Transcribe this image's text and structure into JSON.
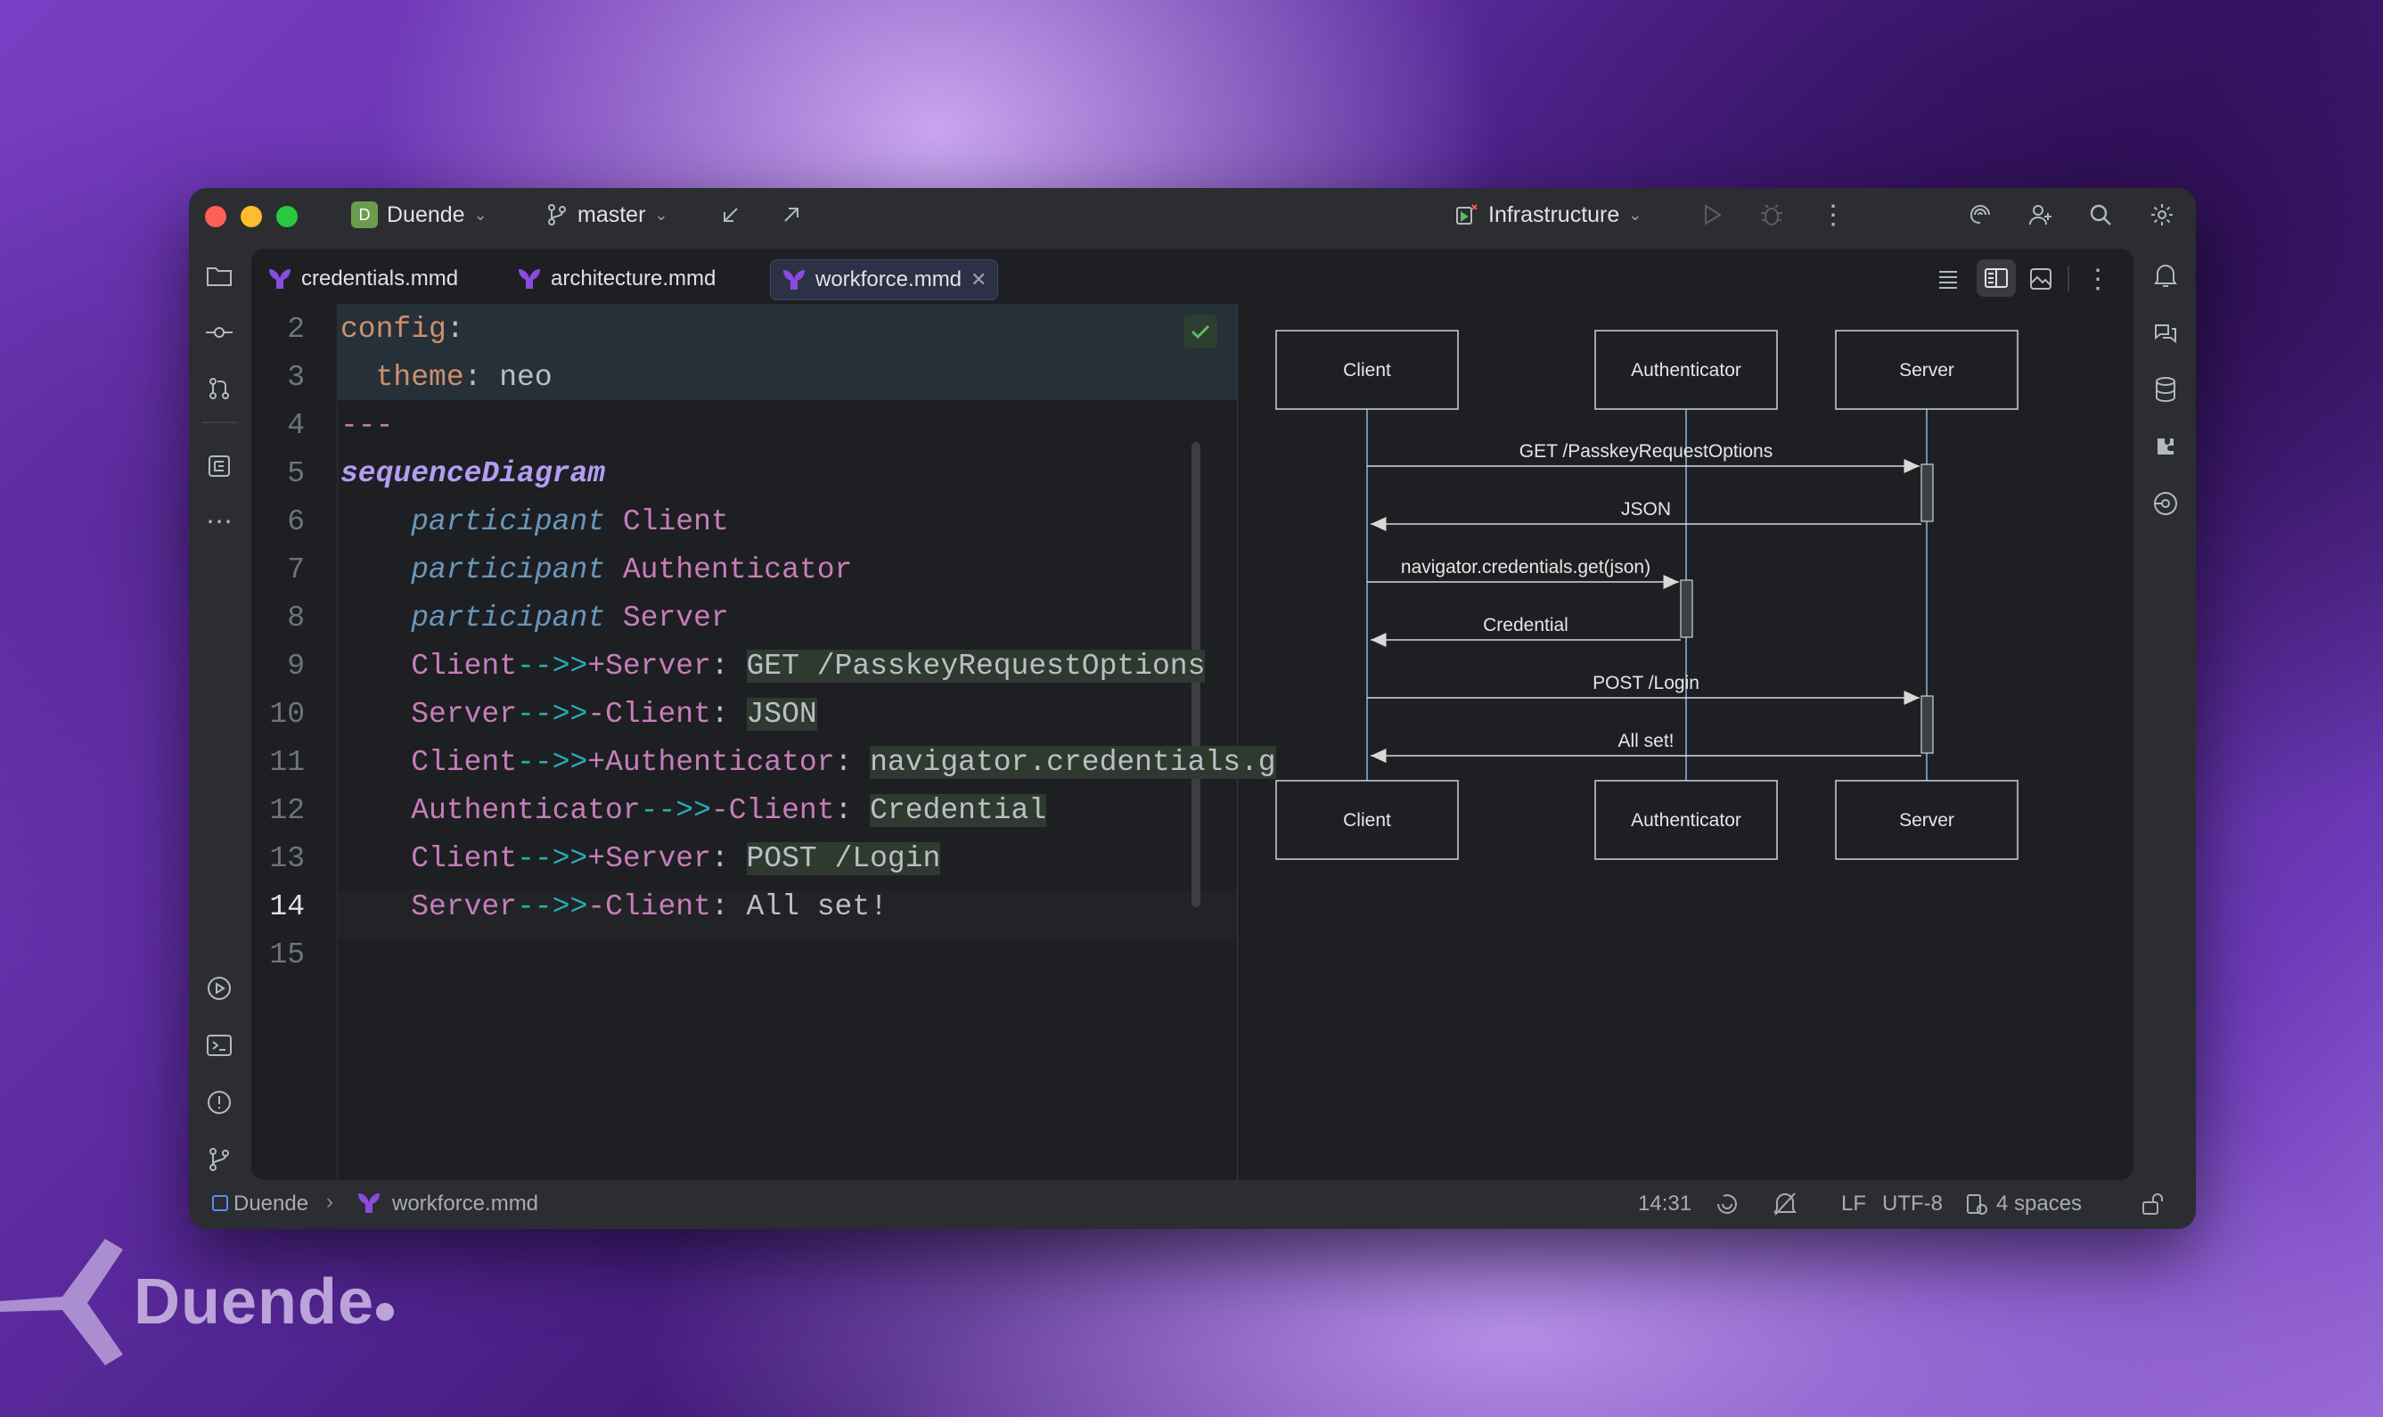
{
  "titlebar": {
    "project_badge": "D",
    "project_name": "Duende",
    "branch": "master",
    "run_config": "Infrastructure"
  },
  "tabs": [
    {
      "label": "credentials.mmd"
    },
    {
      "label": "architecture.mmd"
    },
    {
      "label": "workforce.mmd"
    }
  ],
  "editor": {
    "line_numbers": [
      "2",
      "3",
      "4",
      "5",
      "6",
      "7",
      "8",
      "9",
      "10",
      "11",
      "12",
      "13",
      "14",
      "15"
    ],
    "lines": {
      "l2_key": "config",
      "l2_colon": ":",
      "l3_key": "theme",
      "l3_colon": ": ",
      "l3_val": "neo",
      "l4": "---",
      "l5": "sequenceDiagram",
      "l6_kw": "participant",
      "l6_name": "Client",
      "l7_kw": "participant",
      "l7_name": "Authenticator",
      "l8_kw": "participant",
      "l8_name": "Server",
      "l9_from": "Client",
      "l9_arrow": "-->>",
      "l9_to": "+Server",
      "l9_colon": ": ",
      "l9_msg": "GET /PasskeyRequestOptions",
      "l10_from": "Server",
      "l10_arrow": "-->>",
      "l10_to": "-Client",
      "l10_colon": ": ",
      "l10_msg": "JSON",
      "l11_from": "Client",
      "l11_arrow": "-->>",
      "l11_to": "+Authenticator",
      "l11_colon": ": ",
      "l11_msg": "navigator.credentials.g",
      "l12_from": "Authenticator",
      "l12_arrow": "-->>",
      "l12_to": "-Client",
      "l12_colon": ": ",
      "l12_msg": "Credential",
      "l13_from": "Client",
      "l13_arrow": "-->>",
      "l13_to": "+Server",
      "l13_colon": ": ",
      "l13_msg": "POST /Login",
      "l14_from": "Server",
      "l14_arrow": "-->>",
      "l14_to": "-Client",
      "l14_colon": ": ",
      "l14_msg": "All set!"
    }
  },
  "diagram": {
    "participants": [
      "Client",
      "Authenticator",
      "Server"
    ],
    "messages": [
      {
        "text": "GET /PasskeyRequestOptions"
      },
      {
        "text": "JSON"
      },
      {
        "text": "navigator.credentials.get(json)"
      },
      {
        "text": "Credential"
      },
      {
        "text": "POST /Login"
      },
      {
        "text": "All set!"
      }
    ]
  },
  "statusbar": {
    "project": "Duende",
    "file": "workforce.mmd",
    "position": "14:31",
    "line_sep": "LF",
    "encoding": "UTF-8",
    "indent": "4 spaces"
  },
  "watermark": {
    "text": "Duende"
  },
  "colors": {
    "accent_tab": "#2c3145",
    "mermaid_logo": "#8a4be0",
    "check": "#5fb865"
  }
}
